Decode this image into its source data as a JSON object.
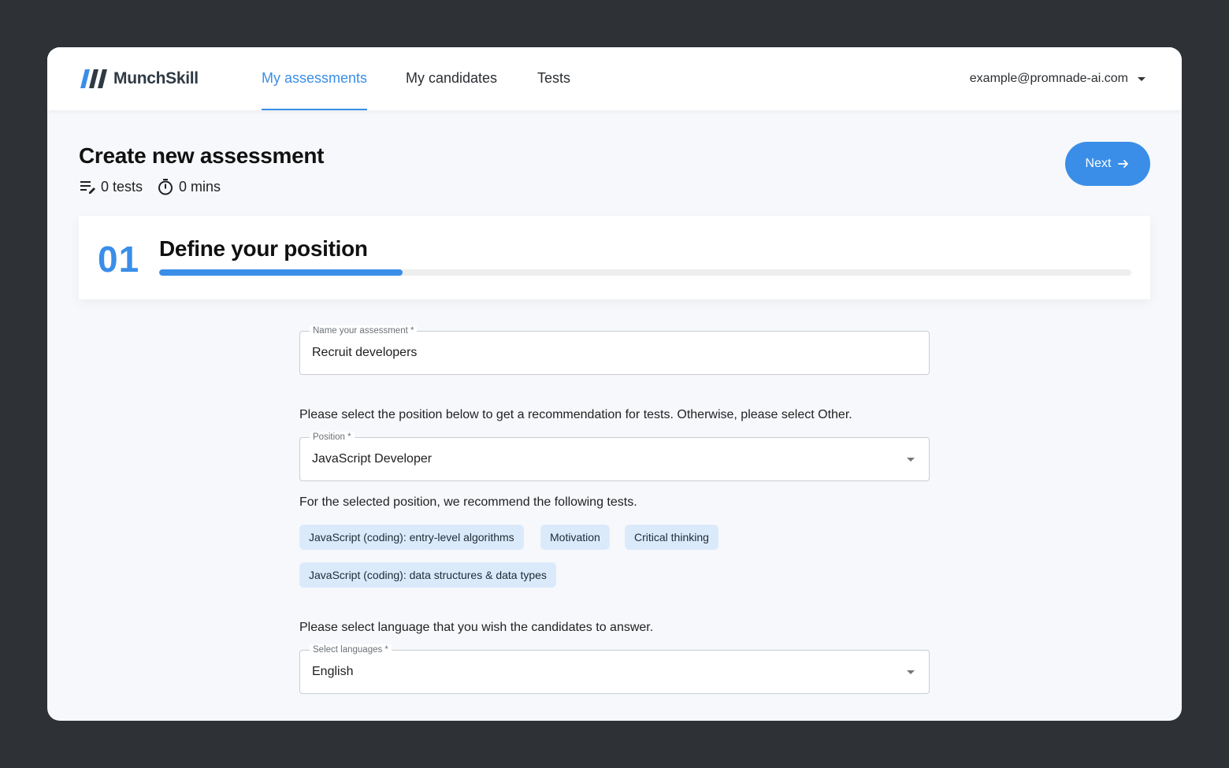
{
  "brand": {
    "name": "MunchSkill"
  },
  "nav": {
    "items": [
      {
        "label": "My assessments",
        "active": true
      },
      {
        "label": "My candidates",
        "active": false
      },
      {
        "label": "Tests",
        "active": false
      }
    ]
  },
  "account": {
    "email": "example@promnade-ai.com"
  },
  "header": {
    "title": "Create new assessment",
    "tests_count": "0 tests",
    "duration": "0 mins",
    "next_label": "Next"
  },
  "step": {
    "number": "01",
    "title": "Define your position",
    "progress_fraction": 0.25
  },
  "form": {
    "name": {
      "label": "Name your assessment *",
      "value": "Recruit developers"
    },
    "position_prompt": "Please select the position below to get a recommendation for tests. Otherwise, please select Other.",
    "position": {
      "label": "Position *",
      "value": "JavaScript Developer"
    },
    "recommend_text": "For the selected position, we recommend the following tests.",
    "recommended_tests": [
      "JavaScript (coding): entry-level algorithms",
      "Motivation",
      "Critical thinking",
      "JavaScript (coding): data structures & data types"
    ],
    "language_prompt": "Please select language that you wish the candidates to answer.",
    "language": {
      "label": "Select languages *",
      "value": "English"
    }
  },
  "colors": {
    "accent": "#3a8ee8",
    "chip_bg": "#dbeafb",
    "backdrop": "#2e3236",
    "page_bg": "#f6f8fb"
  },
  "icons": {
    "logo": "munchskill-logo-icon",
    "tests": "playlist-edit-icon",
    "timer": "timer-icon",
    "next": "arrow-right-icon",
    "dropdown": "caret-down-icon"
  }
}
